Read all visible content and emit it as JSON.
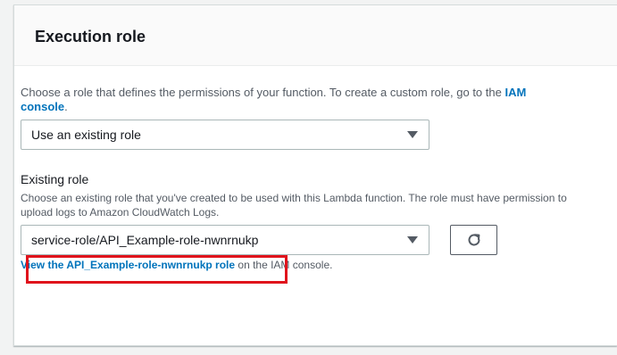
{
  "panel": {
    "title": "Execution role"
  },
  "intro": {
    "text": "Choose a role that defines the permissions of your function. To create a custom role, go to the ",
    "link_label": "IAM console",
    "suffix": "."
  },
  "role_type_select": {
    "value": "Use an existing role"
  },
  "existing_role": {
    "label": "Existing role",
    "description": "Choose an existing role that you've created to be used with this Lambda function. The role must have permission to upload logs to Amazon CloudWatch Logs.",
    "value": "service-role/API_Example-role-nwnrnukp"
  },
  "view_role": {
    "link_label": "View the API_Example-role-nwnrnukp role",
    "suffix": " on the IAM console."
  },
  "icons": {
    "caret": "caret-down-icon",
    "refresh": "refresh-icon"
  },
  "colors": {
    "link": "#0073bb",
    "highlight": "#e0131c"
  }
}
